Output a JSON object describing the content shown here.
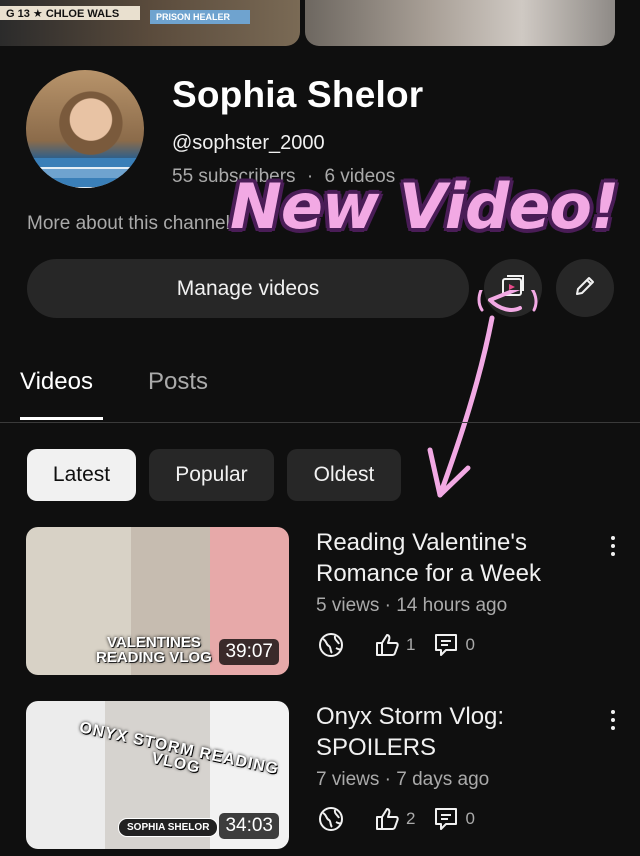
{
  "banner": {
    "spine_text": "G 13 ★ CHLOE WALS",
    "spine_text_2": "PRISON HEALER"
  },
  "channel": {
    "name": "Sophia Shelor",
    "handle": "@sophster_2000",
    "subscribers": "55 subscribers",
    "videos_count": "6 videos",
    "separator": "·",
    "more_about": "More about this channel"
  },
  "overlay": {
    "text": "New Video!",
    "color": "#f2a9e4"
  },
  "actions": {
    "manage_videos": "Manage videos",
    "icons": [
      "video-library-icon",
      "pencil-icon"
    ]
  },
  "tabs": [
    {
      "label": "Videos",
      "active": true
    },
    {
      "label": "Posts",
      "active": false
    }
  ],
  "filters": [
    {
      "label": "Latest",
      "active": true
    },
    {
      "label": "Popular",
      "active": false
    },
    {
      "label": "Oldest",
      "active": false
    }
  ],
  "videos": [
    {
      "title": "Reading Valentine's Romance for a Week",
      "meta": "5 views · 14 hours ago",
      "duration": "39:07",
      "likes": "1",
      "comments": "0",
      "thumb_caption": "VALENTINES\nREADING VLOG"
    },
    {
      "title": "Onyx Storm Vlog: SPOILERS",
      "meta": "7 views · 7 days ago",
      "duration": "34:03",
      "likes": "2",
      "comments": "0",
      "thumb_caption": "ONYX STORM READING VLOG",
      "thumb_pill": "SOPHIA SHELOR"
    }
  ]
}
